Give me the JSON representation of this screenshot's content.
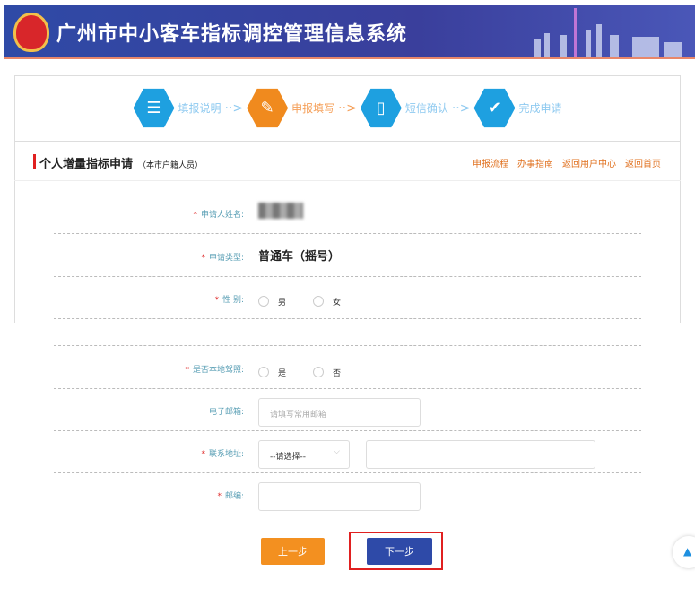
{
  "header": {
    "title": "广州市中小客车指标调控管理信息系统"
  },
  "steps": [
    {
      "label": "填报说明"
    },
    {
      "label": "申报填写"
    },
    {
      "label": "短信确认"
    },
    {
      "label": "完成申请"
    }
  ],
  "section": {
    "title": "个人增量指标申请",
    "subtitle": "（本市户籍人员）",
    "links": [
      "申报流程",
      "办事指南",
      "返回用户中心",
      "返回首页"
    ]
  },
  "form": {
    "name": {
      "label": "申请人姓名:"
    },
    "type": {
      "label": "申请类型:",
      "value": "普通车（摇号）"
    },
    "gender": {
      "label": "性 别:",
      "options": [
        "男",
        "女"
      ]
    },
    "local": {
      "label": "是否本地驾照:",
      "options": [
        "是",
        "否"
      ]
    },
    "email": {
      "label": "电子邮箱:",
      "placeholder": "请填写常用邮箱"
    },
    "address": {
      "label": "联系地址:",
      "select": "--请选择--"
    },
    "zip": {
      "label": "邮编:"
    },
    "required_mark": "*"
  },
  "buttons": {
    "prev": "上一步",
    "next": "下一步"
  }
}
